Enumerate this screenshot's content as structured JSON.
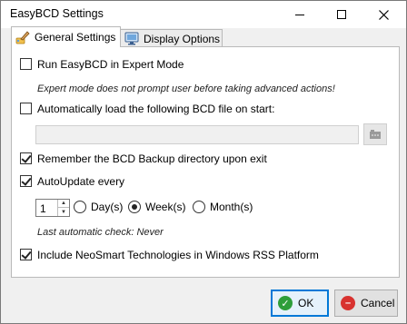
{
  "window": {
    "title": "EasyBCD Settings"
  },
  "tabs": [
    {
      "label": "General Settings",
      "icon": "settings-brush-icon",
      "active": true
    },
    {
      "label": "Display Options",
      "icon": "monitor-icon",
      "active": false
    }
  ],
  "general": {
    "expert_mode": {
      "label": "Run EasyBCD in Expert Mode",
      "checked": false
    },
    "expert_hint": "Expert mode does not prompt user before taking advanced actions!",
    "auto_load": {
      "label": "Automatically load the following BCD file on start:",
      "checked": false
    },
    "bcd_file_value": "",
    "remember_backup": {
      "label": "Remember the BCD Backup directory upon exit",
      "checked": true
    },
    "auto_update": {
      "label": "AutoUpdate every",
      "checked": true
    },
    "update_interval": "1",
    "interval_options": [
      {
        "label": "Day(s)",
        "selected": false
      },
      {
        "label": "Week(s)",
        "selected": true
      },
      {
        "label": "Month(s)",
        "selected": false
      }
    ],
    "last_check": "Last automatic check: Never",
    "rss": {
      "label": "Include NeoSmart Technologies in Windows RSS Platform",
      "checked": true
    }
  },
  "buttons": {
    "ok": "OK",
    "cancel": "Cancel"
  },
  "colors": {
    "accent": "#0078d7",
    "ok_green": "#2e9e3a",
    "cancel_red": "#d8322f"
  }
}
